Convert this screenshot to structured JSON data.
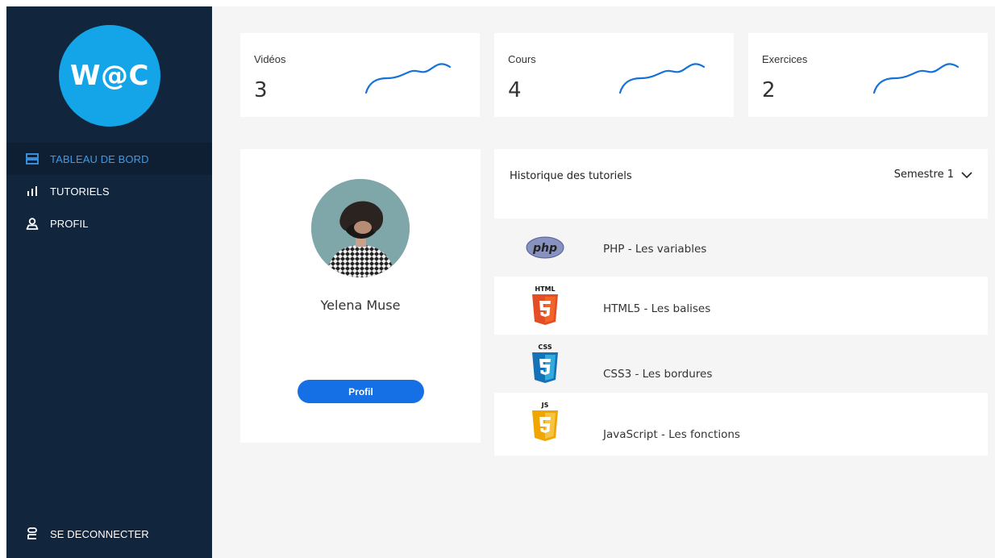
{
  "brand": {
    "logo_text": "W@C"
  },
  "sidebar": {
    "items": [
      {
        "label": "TABLEAU DE BORD",
        "icon": "dashboard-icon"
      },
      {
        "label": "TUTORIELS",
        "icon": "bar-chart-icon"
      },
      {
        "label": "PROFIL",
        "icon": "user-icon"
      }
    ],
    "logout_label": "SE DECONNECTER"
  },
  "stats": [
    {
      "title": "Vidéos",
      "value": "3"
    },
    {
      "title": "Cours",
      "value": "4"
    },
    {
      "title": "Exercices",
      "value": "2"
    }
  ],
  "profile": {
    "name": "Yelena Muse",
    "button_label": "Profil"
  },
  "history": {
    "title": "Historique des tutoriels",
    "period_selected": "Semestre 1",
    "items": [
      {
        "label": "PHP - Les variables",
        "logo": "php",
        "logo_text": "php"
      },
      {
        "label": "HTML5 - Les balises",
        "logo": "html5",
        "logo_text": "HTML"
      },
      {
        "label": "CSS3 - Les bordures",
        "logo": "css3",
        "logo_text": "CSS"
      },
      {
        "label": "JavaScript - Les fonctions",
        "logo": "js",
        "logo_text": "JS"
      }
    ]
  },
  "colors": {
    "sidebar_bg": "#11253d",
    "accent": "#3d9be9",
    "logo_bg": "#14a5e8",
    "button_bg": "#1570e6",
    "html5": "#e44d26",
    "css3": "#1572b6",
    "js": "#f0a500",
    "php": "#8892bf"
  }
}
